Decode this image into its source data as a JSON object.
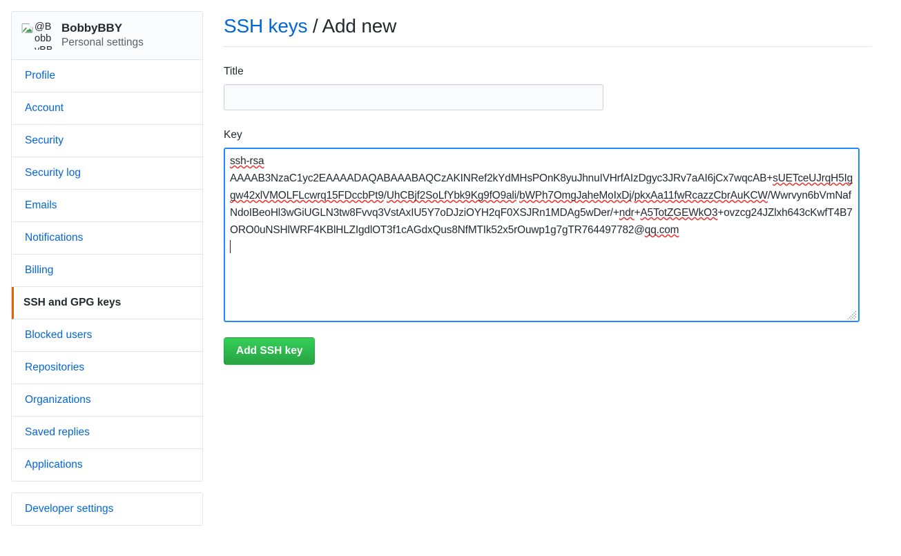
{
  "sidebar": {
    "profile": {
      "avatar_icon": "broken-image-icon",
      "avatar_alt": "@BobbyBBY",
      "username": "BobbyBBY",
      "subtitle": "Personal settings"
    },
    "items": [
      {
        "label": "Profile",
        "selected": false
      },
      {
        "label": "Account",
        "selected": false
      },
      {
        "label": "Security",
        "selected": false
      },
      {
        "label": "Security log",
        "selected": false
      },
      {
        "label": "Emails",
        "selected": false
      },
      {
        "label": "Notifications",
        "selected": false
      },
      {
        "label": "Billing",
        "selected": false
      },
      {
        "label": "SSH and GPG keys",
        "selected": true
      },
      {
        "label": "Blocked users",
        "selected": false
      },
      {
        "label": "Repositories",
        "selected": false
      },
      {
        "label": "Organizations",
        "selected": false
      },
      {
        "label": "Saved replies",
        "selected": false
      },
      {
        "label": "Applications",
        "selected": false
      }
    ],
    "developer_settings": "Developer settings"
  },
  "main": {
    "title_link": "SSH keys",
    "title_separator": " / ",
    "title_current": "Add new",
    "title_field_label": "Title",
    "title_field_value": "",
    "title_field_placeholder": "",
    "key_field_label": "Key",
    "key_field_value": "ssh-rsa\nAAAAB3NzaC1yc2EAAAADAQABAAABAQCzAKINRef2kYdMHsPOnK8yuJhnuIVHrfAIzDgyc3JRv7aAI6jCx7wqcAB+sUETceUJrqH5Iggw42xlVMOLFLcwrq15FDccbPt9/UhCBjf2SoLfYbk9Kg9fO9ali/bWPh7OmgJaheMoIxDj/pkxAa11fwRcazzCbrAuKCW/Wwrvyn6bVmNafNdoIBeoHl3wGiUGLN3tw8Fvvq3VstAxIU5Y7oDJziOYH2qF0XSJRn1MDAg5wDer/+ndr+A5TotZGEWkO3+ovzcg24JZlxh643cKwfT4B7ORO0uNSHlWRF4KBlHLZIgdlOT3f1cAGdxQus8NfMTIk52x5rOuwp1g7gTR764497782@qq.com\n",
    "submit_label": "Add SSH key"
  },
  "colors": {
    "link": "#0366d6",
    "text": "#24292e",
    "muted": "#586069",
    "border": "#e1e4e8",
    "active_marker": "#e36209",
    "focus_border": "#2188ff",
    "button_green": "#28a745",
    "spellcheck_red": "#e7342e"
  }
}
